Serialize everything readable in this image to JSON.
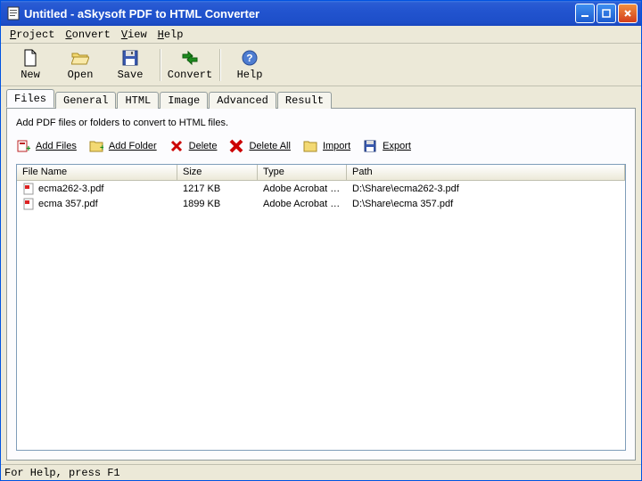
{
  "window": {
    "title": "Untitled - aSkysoft PDF to HTML Converter"
  },
  "menus": {
    "project": "Project",
    "convert": "Convert",
    "view": "View",
    "help": "Help"
  },
  "toolbar": {
    "new": "New",
    "open": "Open",
    "save": "Save",
    "convert": "Convert",
    "help": "Help"
  },
  "tabs": {
    "files": "Files",
    "general": "General",
    "html": "HTML",
    "image": "Image",
    "advanced": "Advanced",
    "result": "Result"
  },
  "panel": {
    "instructions": "Add PDF files or folders to convert to HTML files."
  },
  "actions": {
    "add_files": "Add Files",
    "add_folder": "Add Folder",
    "delete": "Delete",
    "delete_all": "Delete All",
    "import": "Import",
    "export": "Export"
  },
  "columns": {
    "name": "File Name",
    "size": "Size",
    "type": "Type",
    "path": "Path"
  },
  "rows": [
    {
      "name": "ecma262-3.pdf",
      "size": "1217 KB",
      "type": "Adobe Acrobat 7...",
      "path": "D:\\Share\\ecma262-3.pdf"
    },
    {
      "name": "ecma 357.pdf",
      "size": "1899 KB",
      "type": "Adobe Acrobat 7...",
      "path": "D:\\Share\\ecma 357.pdf"
    }
  ],
  "status": "For Help, press F1"
}
